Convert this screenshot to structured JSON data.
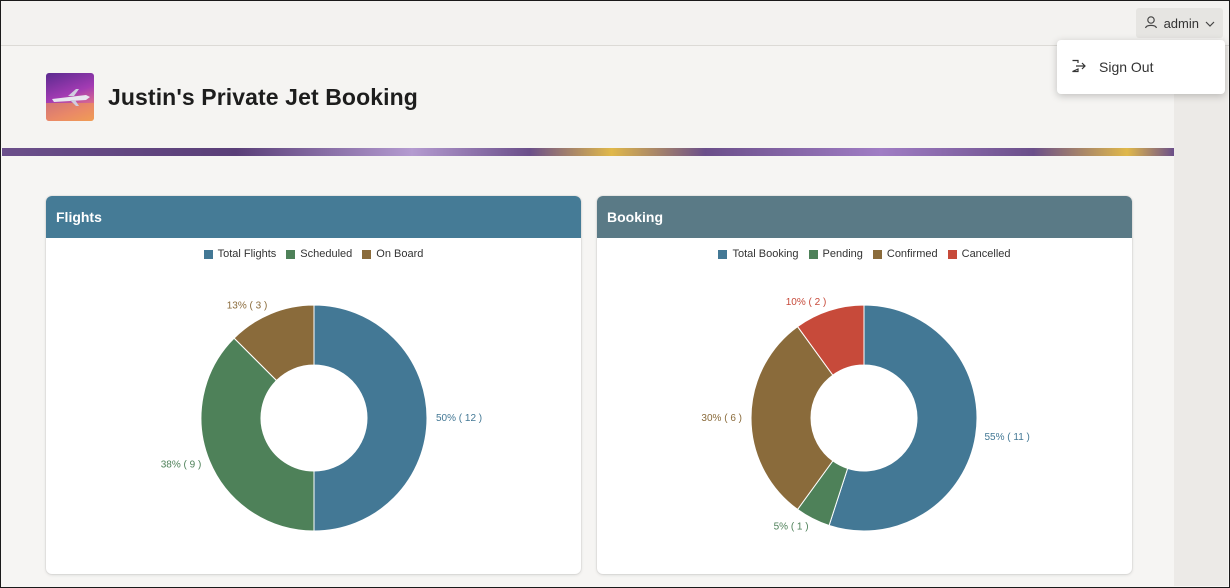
{
  "user": {
    "name": "admin"
  },
  "menu": {
    "sign_out": "Sign Out"
  },
  "app": {
    "title": "Justin's Private Jet Booking"
  },
  "colors": {
    "flights_header": "#457b96",
    "booking_header": "#5a7a86",
    "blue": "#437895",
    "green": "#4e8159",
    "brown": "#8a6b3b",
    "red": "#c74a3a"
  },
  "regions": {
    "flights": {
      "title": "Flights",
      "chart_data": {
        "type": "pie",
        "donut": true,
        "series": [
          {
            "name": "Total Flights",
            "value": 12,
            "label": "50% ( 12 )",
            "color": "#437895"
          },
          {
            "name": "Scheduled",
            "value": 9,
            "label": "38% ( 9 )",
            "color": "#4e8159"
          },
          {
            "name": "On Board",
            "value": 3,
            "label": "13% ( 3 )",
            "color": "#8a6b3b"
          }
        ],
        "legend": "top"
      }
    },
    "booking": {
      "title": "Booking",
      "chart_data": {
        "type": "pie",
        "donut": true,
        "series": [
          {
            "name": "Total Booking",
            "value": 11,
            "label": "55% ( 11 )",
            "color": "#437895"
          },
          {
            "name": "Pending",
            "value": 1,
            "label": "5% ( 1 )",
            "color": "#4e8159"
          },
          {
            "name": "Confirmed",
            "value": 6,
            "label": "30% ( 6 )",
            "color": "#8a6b3b"
          },
          {
            "name": "Cancelled",
            "value": 2,
            "label": "10% ( 2 )",
            "color": "#c74a3a"
          }
        ],
        "legend": "top"
      }
    }
  }
}
